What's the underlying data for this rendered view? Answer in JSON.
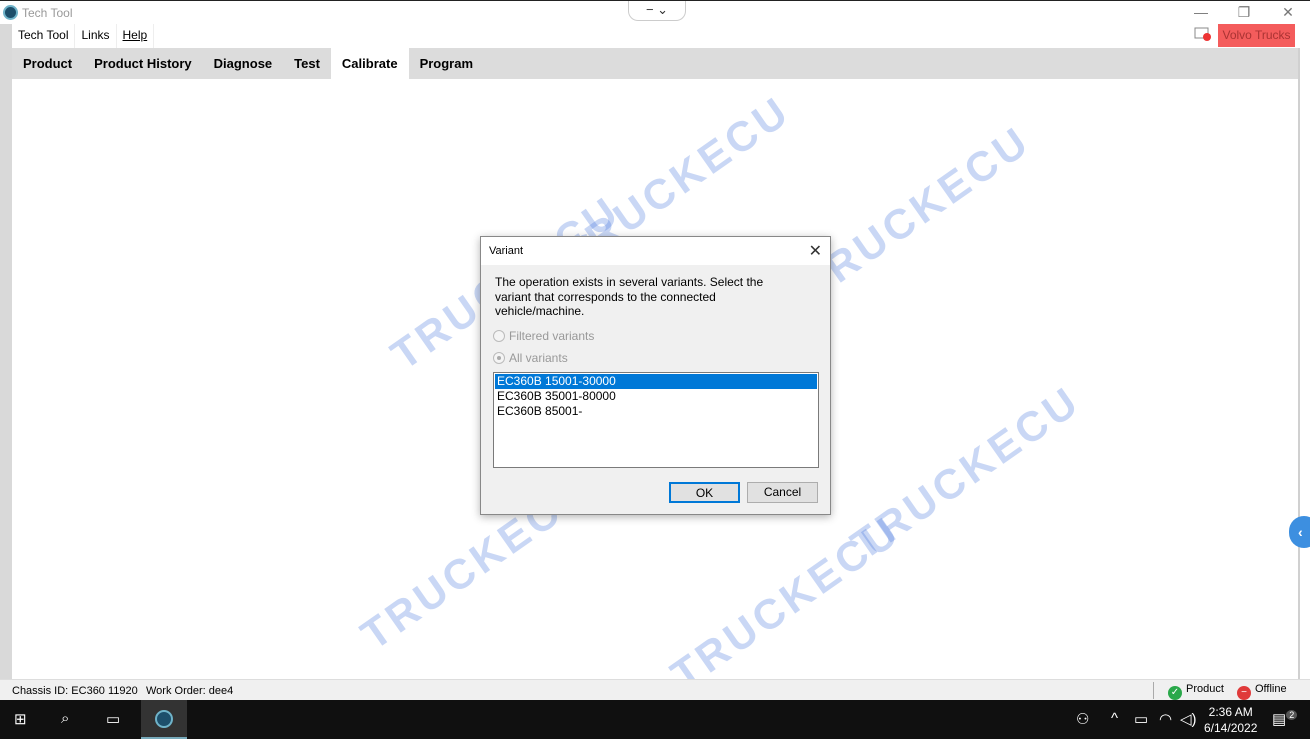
{
  "window": {
    "title": "Tech Tool",
    "center_controls": "−  ⌄",
    "minimize": "—",
    "restore": "❐",
    "close": "✕"
  },
  "menu": [
    "Tech Tool",
    "Links",
    "Help"
  ],
  "brand": {
    "label": "Volvo Trucks",
    "color": "#f45c5c"
  },
  "tabs": [
    {
      "label": "Product"
    },
    {
      "label": "Product History"
    },
    {
      "label": "Diagnose"
    },
    {
      "label": "Test"
    },
    {
      "label": "Calibrate",
      "active": true
    },
    {
      "label": "Program"
    }
  ],
  "watermark": "TRUCKECU",
  "dialog": {
    "title": "Variant",
    "close": "✕",
    "message": "The operation exists in several variants. Select the variant that corresponds to the connected vehicle/machine.",
    "radio_filtered": "Filtered variants",
    "radio_all": "All variants",
    "selected_radio": "All variants",
    "variants": [
      "EC360B 15001-30000",
      "EC360B 35001-80000",
      "EC360B 85001-"
    ],
    "selected_variant": "EC360B 15001-30000",
    "ok": "OK",
    "cancel": "Cancel"
  },
  "side_tab": "‹",
  "status": {
    "chassis": "Chassis ID: EC360 11920",
    "work_order": "Work Order: dee4",
    "product": "Product",
    "offline": "Offline",
    "product_color": "#2aa84a",
    "offline_color": "#e03a3a"
  },
  "taskbar": {
    "time": "2:36 AM",
    "date": "6/14/2022",
    "notifications": "2"
  }
}
